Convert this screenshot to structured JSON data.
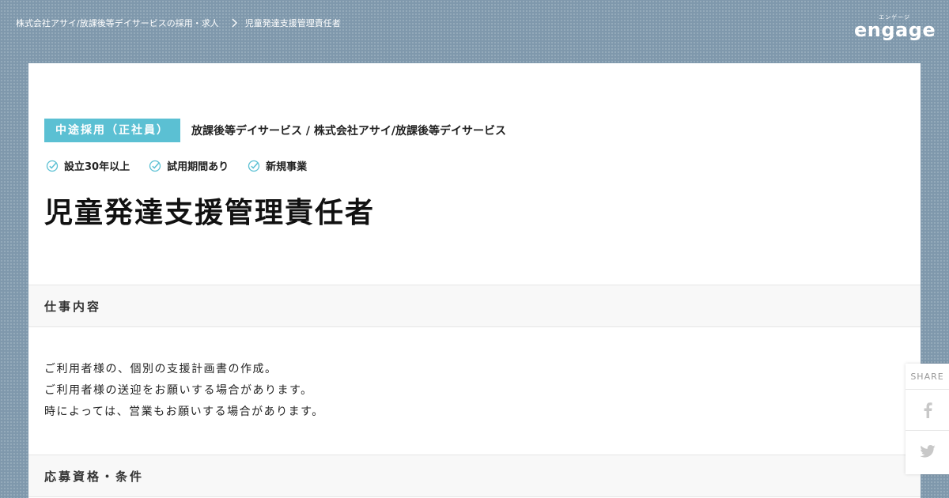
{
  "breadcrumb": {
    "parent": "株式会社アサイ/放課後等デイサービスの採用・求人",
    "current": "児童発達支援管理責任者"
  },
  "logo": {
    "kana": "エンゲージ",
    "word": "engage"
  },
  "job": {
    "employment_type": "中途採用（正社員）",
    "company": "放課後等デイサービス / 株式会社アサイ/放課後等デイサービス",
    "features": [
      "設立30年以上",
      "試用期間あり",
      "新規事業"
    ],
    "title": "児童発達支援管理責任者"
  },
  "sections": {
    "duties_heading": "仕事内容",
    "duties_lines": [
      "ご利用者様の、個別の支援計画書の作成。",
      "ご利用者様の送迎をお願いする場合があります。",
      "時によっては、営業もお願いする場合があります。"
    ],
    "requirements_heading": "応募資格・条件"
  },
  "share": {
    "label": "SHARE",
    "facebook_icon": "facebook-icon",
    "twitter_icon": "twitter-icon"
  },
  "colors": {
    "accent": "#5bc0d3",
    "background": "#7f98ac"
  }
}
